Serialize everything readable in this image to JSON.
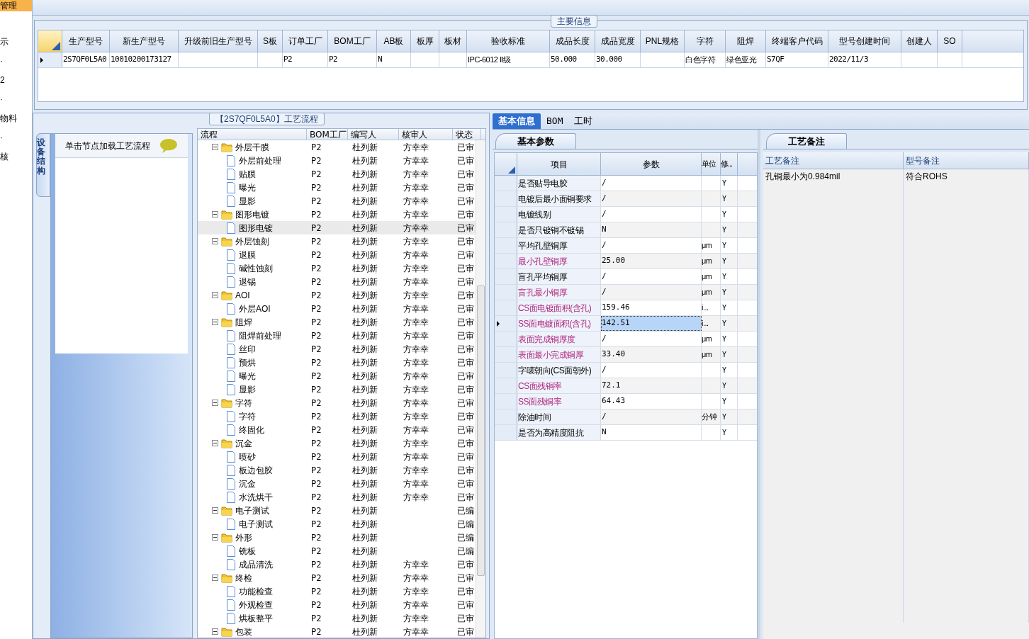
{
  "left_nav": {
    "header": "管理",
    "items": [
      "示",
      "·",
      "2",
      "·",
      "物料",
      "·",
      "核"
    ]
  },
  "main_info": {
    "title": "主要信息",
    "columns": [
      "生产型号",
      "新生产型号",
      "升级前旧生产型号",
      "S板",
      "订单工厂",
      "BOM工厂",
      "AB板",
      "板厚",
      "板材",
      "验收标准",
      "成品长度",
      "成品宽度",
      "PNL规格",
      "字符",
      "阻焊",
      "终端客户代码",
      "型号创建时间",
      "创建人",
      "SO"
    ],
    "rows": [
      {
        "selected": true,
        "cells": [
          "2S7QF0L5A0",
          "10010200173127",
          "",
          "",
          "P2",
          "P2",
          "N",
          "",
          "",
          "IPC-6012 Ⅱ级",
          "50.000",
          "30.000",
          "",
          "白色字符",
          "绿色亚光",
          "S7QF",
          "2022/11/3",
          "",
          ""
        ]
      }
    ]
  },
  "process_flow": {
    "title": "【2S7QF0L5A0】工艺流程",
    "side_tab": "设备结构",
    "hint": "单击节点加载工艺流程",
    "columns": [
      "流程",
      "BOM工厂",
      "编写人",
      "核审人",
      "状态"
    ],
    "tree": [
      {
        "name": "外层干膜",
        "bom": "P2",
        "writer": "杜列新",
        "reviewer": "方幸幸",
        "status": "已审",
        "expanded": true,
        "selected": false,
        "children": [
          {
            "name": "外层前处理",
            "bom": "P2",
            "writer": "杜列新",
            "reviewer": "方幸幸",
            "status": "已审",
            "selected": false
          },
          {
            "name": "贴膜",
            "bom": "P2",
            "writer": "杜列新",
            "reviewer": "方幸幸",
            "status": "已审",
            "selected": false
          },
          {
            "name": "曝光",
            "bom": "P2",
            "writer": "杜列新",
            "reviewer": "方幸幸",
            "status": "已审",
            "selected": false
          },
          {
            "name": "显影",
            "bom": "P2",
            "writer": "杜列新",
            "reviewer": "方幸幸",
            "status": "已审",
            "selected": false
          }
        ]
      },
      {
        "name": "图形电镀",
        "bom": "P2",
        "writer": "杜列新",
        "reviewer": "方幸幸",
        "status": "已审",
        "expanded": true,
        "selected": false,
        "children": [
          {
            "name": "图形电镀",
            "bom": "P2",
            "writer": "杜列新",
            "reviewer": "方幸幸",
            "status": "已审",
            "selected": true
          }
        ]
      },
      {
        "name": "外层蚀刻",
        "bom": "P2",
        "writer": "杜列新",
        "reviewer": "方幸幸",
        "status": "已审",
        "expanded": true,
        "selected": false,
        "children": [
          {
            "name": "退膜",
            "bom": "P2",
            "writer": "杜列新",
            "reviewer": "方幸幸",
            "status": "已审",
            "selected": false
          },
          {
            "name": "碱性蚀刻",
            "bom": "P2",
            "writer": "杜列新",
            "reviewer": "方幸幸",
            "status": "已审",
            "selected": false
          },
          {
            "name": "退锡",
            "bom": "P2",
            "writer": "杜列新",
            "reviewer": "方幸幸",
            "status": "已审",
            "selected": false
          }
        ]
      },
      {
        "name": "AOI",
        "bom": "P2",
        "writer": "杜列新",
        "reviewer": "方幸幸",
        "status": "已审",
        "expanded": true,
        "selected": false,
        "children": [
          {
            "name": "外层AOI",
            "bom": "P2",
            "writer": "杜列新",
            "reviewer": "方幸幸",
            "status": "已审",
            "selected": false
          }
        ]
      },
      {
        "name": "阻焊",
        "bom": "P2",
        "writer": "杜列新",
        "reviewer": "方幸幸",
        "status": "已审",
        "expanded": true,
        "selected": false,
        "children": [
          {
            "name": "阻焊前处理",
            "bom": "P2",
            "writer": "杜列新",
            "reviewer": "方幸幸",
            "status": "已审",
            "selected": false
          },
          {
            "name": "丝印",
            "bom": "P2",
            "writer": "杜列新",
            "reviewer": "方幸幸",
            "status": "已审",
            "selected": false
          },
          {
            "name": "预烘",
            "bom": "P2",
            "writer": "杜列新",
            "reviewer": "方幸幸",
            "status": "已审",
            "selected": false
          },
          {
            "name": "曝光",
            "bom": "P2",
            "writer": "杜列新",
            "reviewer": "方幸幸",
            "status": "已审",
            "selected": false
          },
          {
            "name": "显影",
            "bom": "P2",
            "writer": "杜列新",
            "reviewer": "方幸幸",
            "status": "已审",
            "selected": false
          }
        ]
      },
      {
        "name": "字符",
        "bom": "P2",
        "writer": "杜列新",
        "reviewer": "方幸幸",
        "status": "已审",
        "expanded": true,
        "selected": false,
        "children": [
          {
            "name": "字符",
            "bom": "P2",
            "writer": "杜列新",
            "reviewer": "方幸幸",
            "status": "已审",
            "selected": false
          },
          {
            "name": "终固化",
            "bom": "P2",
            "writer": "杜列新",
            "reviewer": "方幸幸",
            "status": "已审",
            "selected": false
          }
        ]
      },
      {
        "name": "沉金",
        "bom": "P2",
        "writer": "杜列新",
        "reviewer": "方幸幸",
        "status": "已审",
        "expanded": true,
        "selected": false,
        "children": [
          {
            "name": "喷砂",
            "bom": "P2",
            "writer": "杜列新",
            "reviewer": "方幸幸",
            "status": "已审",
            "selected": false
          },
          {
            "name": "板边包胶",
            "bom": "P2",
            "writer": "杜列新",
            "reviewer": "方幸幸",
            "status": "已审",
            "selected": false
          },
          {
            "name": "沉金",
            "bom": "P2",
            "writer": "杜列新",
            "reviewer": "方幸幸",
            "status": "已审",
            "selected": false
          },
          {
            "name": "水洗烘干",
            "bom": "P2",
            "writer": "杜列新",
            "reviewer": "方幸幸",
            "status": "已审",
            "selected": false
          }
        ]
      },
      {
        "name": "电子测试",
        "bom": "P2",
        "writer": "杜列新",
        "status": "已编",
        "expanded": true,
        "selected": false,
        "children": [
          {
            "name": "电子测试",
            "bom": "P2",
            "writer": "杜列新",
            "status": "已编",
            "selected": false
          }
        ]
      },
      {
        "name": "外形",
        "bom": "P2",
        "writer": "杜列新",
        "status": "已编",
        "expanded": true,
        "selected": false,
        "children": [
          {
            "name": "铣板",
            "bom": "P2",
            "writer": "杜列新",
            "status": "已编",
            "selected": false
          },
          {
            "name": "成品清洗",
            "bom": "P2",
            "writer": "杜列新",
            "reviewer": "方幸幸",
            "status": "已审",
            "selected": false
          }
        ]
      },
      {
        "name": "终检",
        "bom": "P2",
        "writer": "杜列新",
        "reviewer": "方幸幸",
        "status": "已审",
        "expanded": true,
        "selected": false,
        "children": [
          {
            "name": "功能检查",
            "bom": "P2",
            "writer": "杜列新",
            "reviewer": "方幸幸",
            "status": "已审",
            "selected": false
          },
          {
            "name": "外观检查",
            "bom": "P2",
            "writer": "杜列新",
            "reviewer": "方幸幸",
            "status": "已审",
            "selected": false
          },
          {
            "name": "烘板整平",
            "bom": "P2",
            "writer": "杜列新",
            "reviewer": "方幸幸",
            "status": "已审",
            "selected": false
          }
        ]
      },
      {
        "name": "包装",
        "bom": "P2",
        "writer": "杜列新",
        "reviewer": "方幸幸",
        "status": "已审",
        "expanded": true,
        "selected": false
      }
    ]
  },
  "detail_tabs": [
    {
      "label": "基本信息",
      "selected": true
    },
    {
      "label": "BOM",
      "selected": false
    },
    {
      "label": "工时",
      "selected": false
    }
  ],
  "basic_params": {
    "title": "基本参数",
    "columns": [
      "项目",
      "参数",
      "单位",
      "修..."
    ],
    "rows": [
      {
        "item": "是否贴导电胶",
        "value": "/",
        "modifiable": "Y",
        "highlight": false,
        "selected": false
      },
      {
        "item": "电镀后最小面铜要求",
        "value": "/",
        "modifiable": "Y",
        "highlight": false,
        "selected": false
      },
      {
        "item": "电镀线别",
        "value": "/",
        "modifiable": "Y",
        "highlight": false,
        "selected": false
      },
      {
        "item": "是否只镀铜不镀锡",
        "value": "N",
        "modifiable": "Y",
        "highlight": false,
        "selected": false
      },
      {
        "item": "平均孔壁铜厚",
        "value": "/",
        "unit": "μm",
        "modifiable": "Y",
        "highlight": false,
        "selected": false
      },
      {
        "item": "最小孔壁铜厚",
        "value": "25.00",
        "unit": "μm",
        "modifiable": "Y",
        "highlight": true,
        "selected": false
      },
      {
        "item": "盲孔平均铜厚",
        "value": "/",
        "unit": "μm",
        "modifiable": "Y",
        "highlight": false,
        "selected": false
      },
      {
        "item": "盲孔最小铜厚",
        "value": "/",
        "unit": "μm",
        "modifiable": "Y",
        "highlight": true,
        "selected": false
      },
      {
        "item": "CS面电镀面积(含孔)",
        "value": "159.46",
        "unit": "i...",
        "modifiable": "Y",
        "highlight": true,
        "selected": false
      },
      {
        "item": "SS面电镀面积(含孔)",
        "value": "142.51",
        "unit": "i...",
        "modifiable": "Y",
        "highlight": true,
        "selected": true
      },
      {
        "item": "表面完成铜厚度",
        "value": "/",
        "unit": "μm",
        "modifiable": "Y",
        "highlight": true,
        "selected": false
      },
      {
        "item": "表面最小完成铜厚",
        "value": "33.40",
        "unit": "μm",
        "modifiable": "Y",
        "highlight": true,
        "selected": false
      },
      {
        "item": "字唛朝向(CS面朝外)",
        "value": "/",
        "modifiable": "Y",
        "highlight": false,
        "selected": false
      },
      {
        "item": "CS面残铜率",
        "value": "72.1",
        "modifiable": "Y",
        "highlight": true,
        "selected": false
      },
      {
        "item": "SS面残铜率",
        "value": "64.43",
        "modifiable": "Y",
        "highlight": true,
        "selected": false
      },
      {
        "item": "除油时间",
        "value": "/",
        "unit": "分钟",
        "modifiable": "Y",
        "highlight": false,
        "selected": false
      },
      {
        "item": "是否为高精度阻抗",
        "value": "N",
        "modifiable": "Y",
        "highlight": false,
        "selected": false
      }
    ]
  },
  "process_notes": {
    "title": "工艺备注",
    "columns": [
      "工艺备注",
      "型号备注"
    ],
    "rows": [
      [
        "孔铜最小为0.984mil",
        "符合ROHS"
      ]
    ]
  }
}
